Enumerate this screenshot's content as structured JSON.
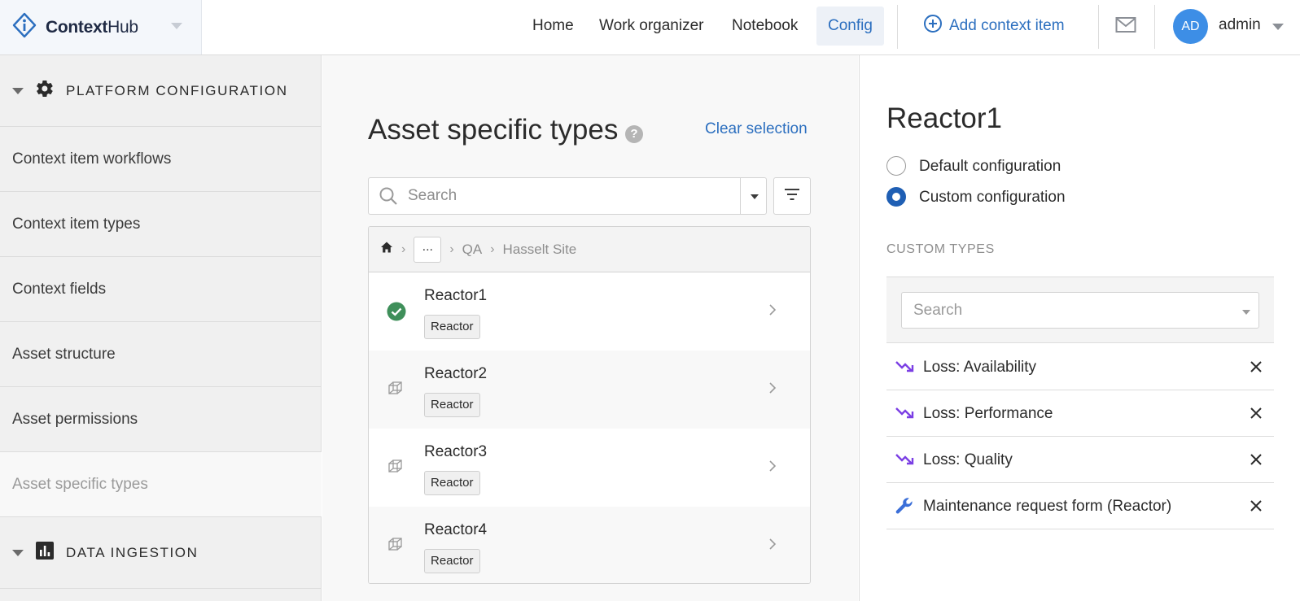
{
  "brand": {
    "name_bold": "Context",
    "name_light": "Hub"
  },
  "nav": {
    "items": [
      {
        "label": "Home",
        "active": false
      },
      {
        "label": "Work organizer",
        "active": false
      },
      {
        "label": "Notebook",
        "active": false
      },
      {
        "label": "Config",
        "active": true
      }
    ],
    "add_label": "Add context item"
  },
  "user": {
    "initials": "AD",
    "name": "admin"
  },
  "colors": {
    "accent": "#2c6fbf",
    "avatar": "#3d8ee6",
    "success": "#3f8f5a",
    "loss_icon": "#7b3fe4",
    "wrench_icon": "#3b6fd8"
  },
  "sidebar": {
    "sections": [
      {
        "title": "PLATFORM CONFIGURATION",
        "icon": "gear-icon"
      },
      {
        "title": "DATA INGESTION",
        "icon": "bar-chart-icon"
      }
    ],
    "items": [
      {
        "label": "Context item workflows",
        "active": false
      },
      {
        "label": "Context item types",
        "active": false
      },
      {
        "label": "Context fields",
        "active": false
      },
      {
        "label": "Asset structure",
        "active": false
      },
      {
        "label": "Asset permissions",
        "active": false
      },
      {
        "label": "Asset specific types",
        "active": true
      }
    ]
  },
  "middle": {
    "title": "Asset specific types",
    "help_glyph": "?",
    "clear_label": "Clear selection",
    "search_placeholder": "Search",
    "breadcrumb": {
      "more": "...",
      "items": [
        "QA",
        "Hasselt Site"
      ]
    },
    "assets": [
      {
        "name": "Reactor1",
        "tag": "Reactor",
        "status": "configured"
      },
      {
        "name": "Reactor2",
        "tag": "Reactor",
        "status": "default"
      },
      {
        "name": "Reactor3",
        "tag": "Reactor",
        "status": "default"
      },
      {
        "name": "Reactor4",
        "tag": "Reactor",
        "status": "default"
      }
    ]
  },
  "detail": {
    "title": "Reactor1",
    "options": [
      {
        "label": "Default configuration",
        "checked": false
      },
      {
        "label": "Custom configuration",
        "checked": true
      }
    ],
    "custom_types_heading": "CUSTOM TYPES",
    "search_placeholder": "Search",
    "types": [
      {
        "label": "Loss: Availability",
        "icon": "trending-down-icon"
      },
      {
        "label": "Loss: Performance",
        "icon": "trending-down-icon"
      },
      {
        "label": "Loss: Quality",
        "icon": "trending-down-icon"
      },
      {
        "label": "Maintenance request form (Reactor)",
        "icon": "wrench-icon"
      }
    ]
  }
}
